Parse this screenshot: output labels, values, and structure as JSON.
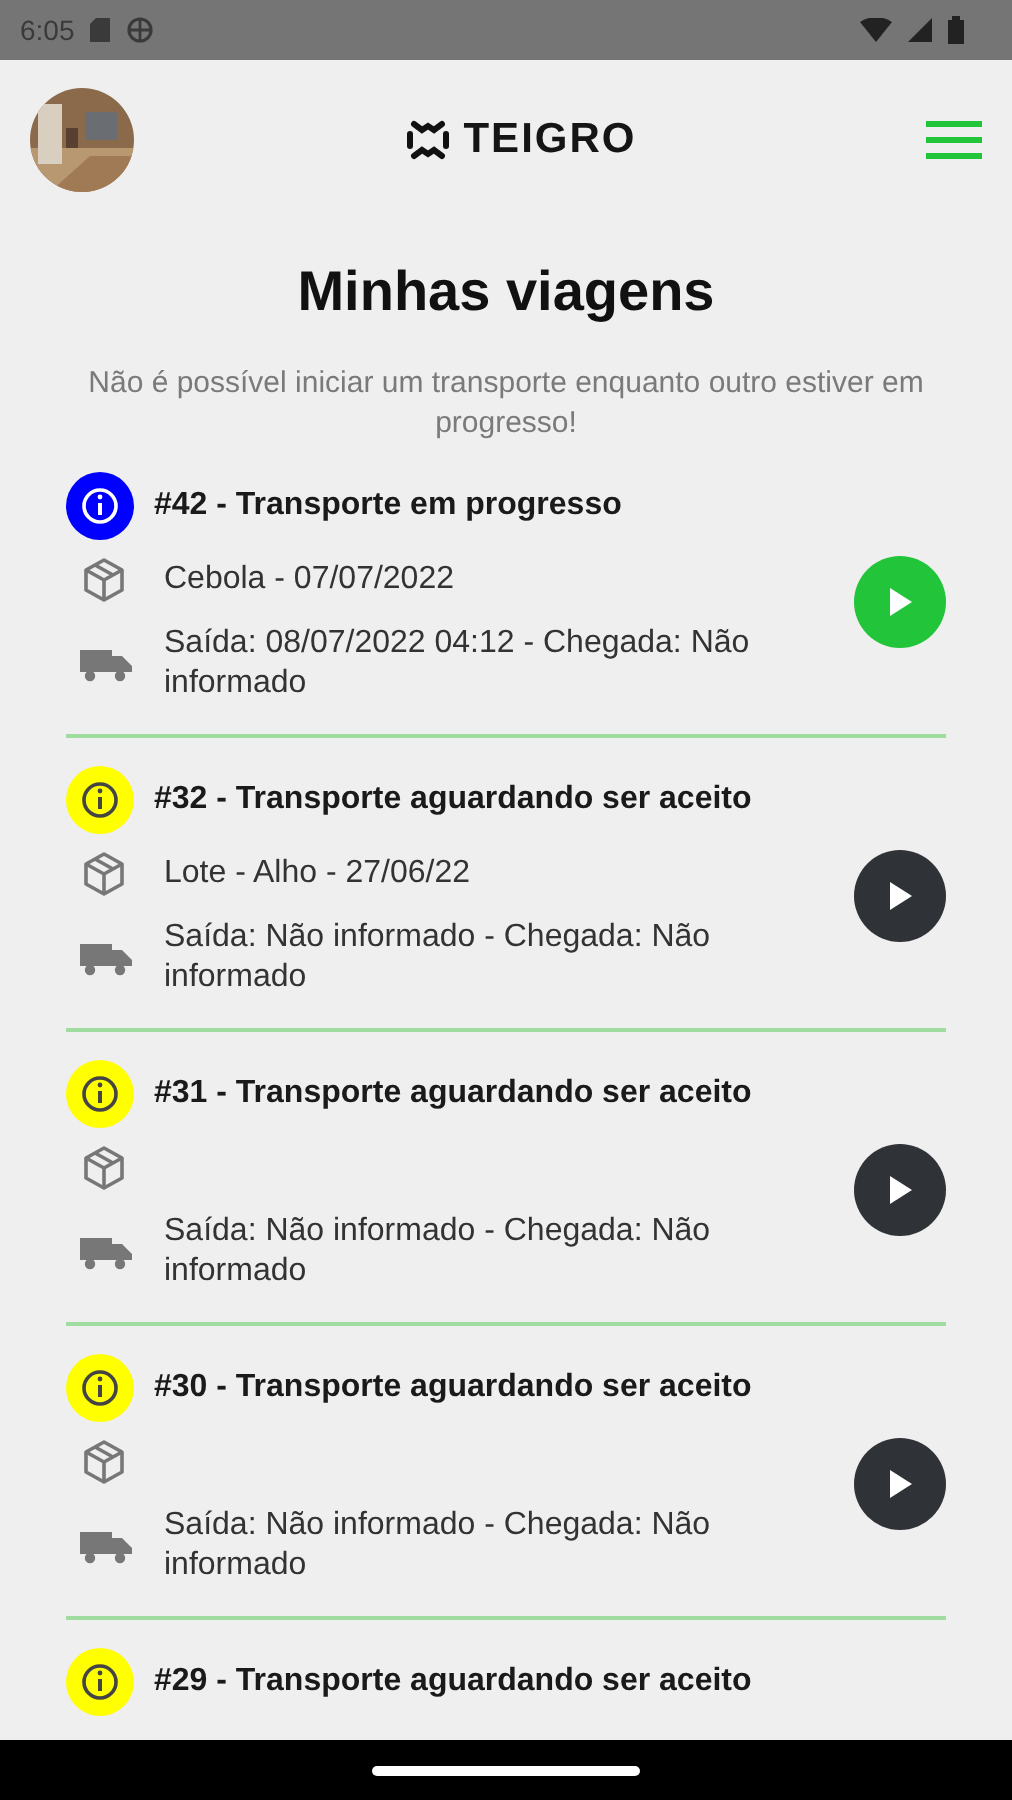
{
  "status_bar": {
    "time": "6:05"
  },
  "header": {
    "logo": "TEIGRO"
  },
  "title": "Minhas viagens",
  "notice": "Não é possível iniciar um transporte enquanto outro estiver em progresso!",
  "trips": [
    {
      "title": "#42 - Transporte em progresso",
      "color": "#0000ff",
      "active": true,
      "product": "Cebola - 07/07/2022",
      "route": "Saída: 08/07/2022 04:12 - Chegada: Não informado"
    },
    {
      "title": "#32 - Transporte aguardando ser aceito",
      "color": "#ffff00",
      "active": false,
      "product": "Lote - Alho - 27/06/22",
      "route": "Saída: Não informado - Chegada: Não informado"
    },
    {
      "title": "#31 - Transporte aguardando ser aceito",
      "color": "#ffff00",
      "active": false,
      "route": "Saída: Não informado - Chegada: Não informado"
    },
    {
      "title": "#30 - Transporte aguardando ser aceito",
      "color": "#ffff00",
      "active": false,
      "route": "Saída: Não informado - Chegada: Não informado"
    },
    {
      "title": "#29 - Transporte aguardando ser aceito",
      "color": "#ffff00"
    }
  ]
}
